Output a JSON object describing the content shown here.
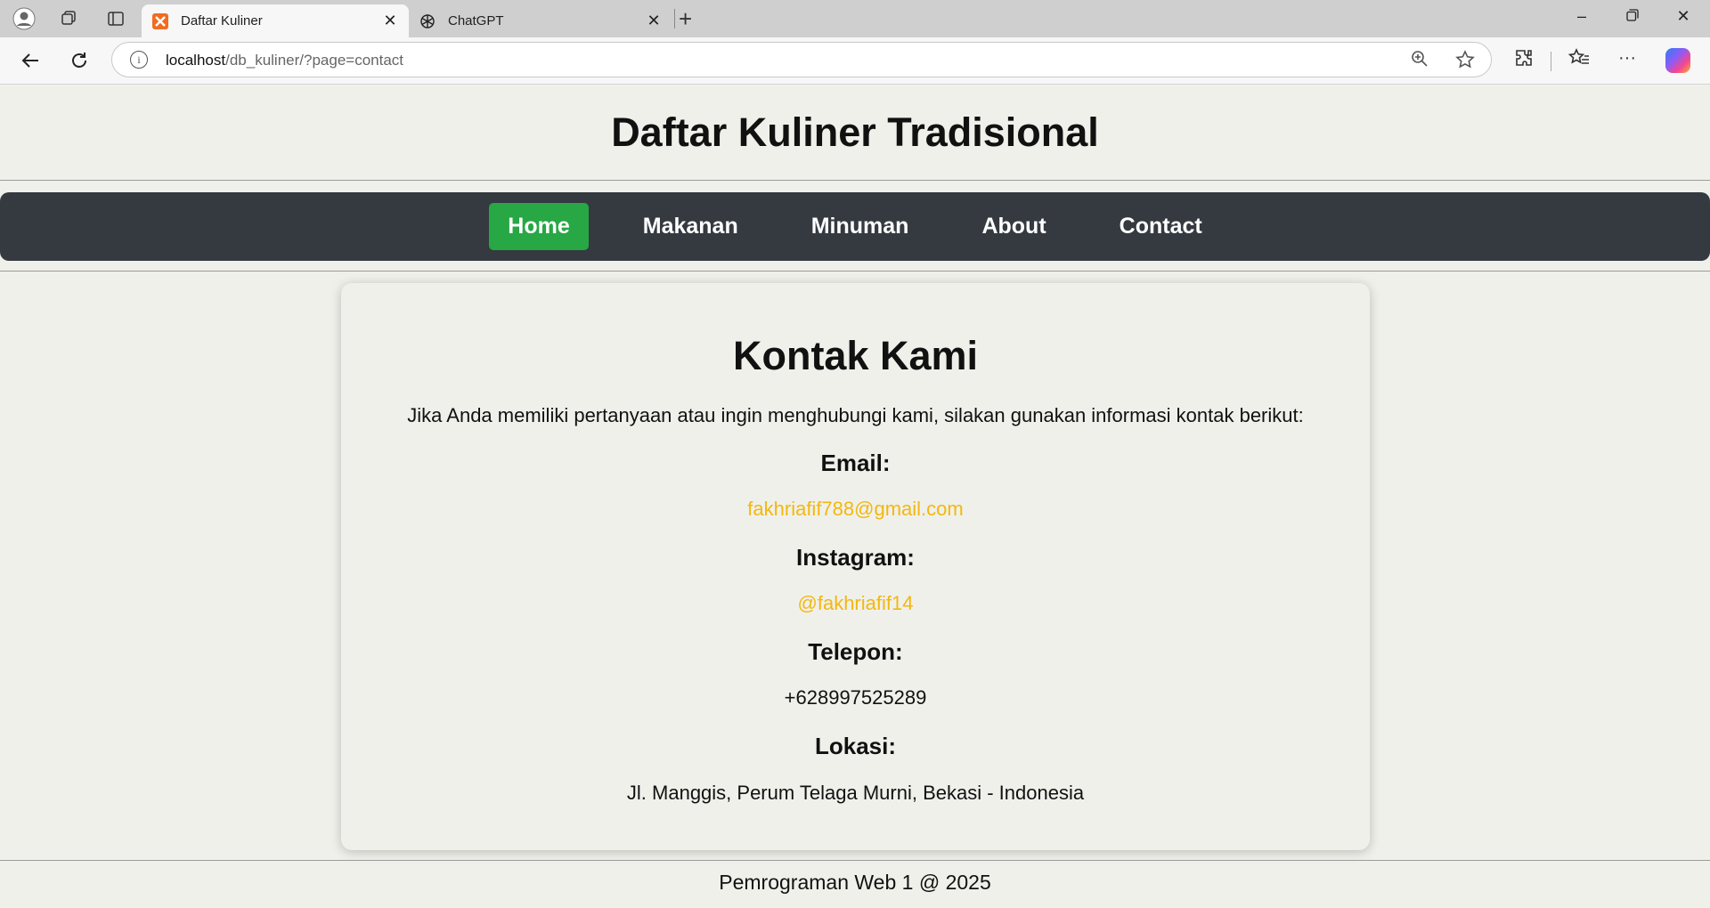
{
  "browser": {
    "tabs": [
      {
        "label": "Daftar Kuliner",
        "active": true,
        "favicon_color": "#f26b21"
      },
      {
        "label": "ChatGPT",
        "active": false
      }
    ],
    "url_host": "localhost",
    "url_path": "/db_kuliner/?page=contact"
  },
  "site": {
    "title": "Daftar Kuliner Tradisional",
    "nav": [
      {
        "label": "Home",
        "active": true
      },
      {
        "label": "Makanan",
        "active": false
      },
      {
        "label": "Minuman",
        "active": false
      },
      {
        "label": "About",
        "active": false
      },
      {
        "label": "Contact",
        "active": false
      }
    ],
    "nav_active_color": "#28a745",
    "nav_bg_color": "#343a40"
  },
  "contact": {
    "heading": "Kontak Kami",
    "intro": "Jika Anda memiliki pertanyaan atau ingin menghubungi kami, silakan gunakan informasi kontak berikut:",
    "email_label": "Email:",
    "email": "fakhriafif788@gmail.com",
    "instagram_label": "Instagram:",
    "instagram": "@fakhriafif14",
    "phone_label": "Telepon:",
    "phone": "+628997525289",
    "location_label": "Lokasi:",
    "location": "Jl. Manggis, Perum Telaga Murni, Bekasi - Indonesia",
    "link_color": "#f2b80f"
  },
  "footer": {
    "text": "Pemrograman Web 1 @ 2025"
  }
}
